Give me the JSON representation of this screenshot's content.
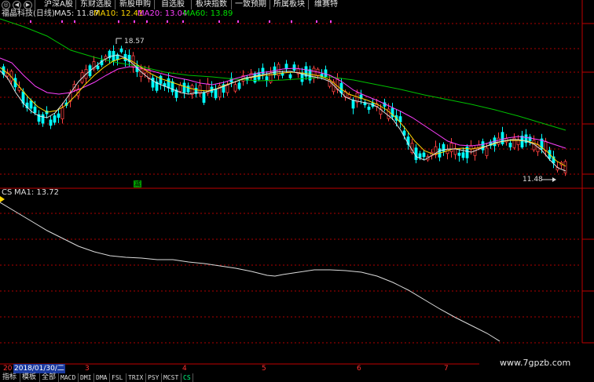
{
  "nav": {
    "icons": [
      "circle-icon",
      "left-arrow-icon",
      "right-arrow-icon"
    ],
    "tabs": [
      "沪深A股",
      "东财选股",
      "新股申购",
      "自选股",
      "板块指数",
      "一致预期",
      "所属板块",
      "维赛特"
    ]
  },
  "header": {
    "stock_name": "福晶科技(日线)",
    "ma5": "MA5: 11.87",
    "ma10": "MA10: 12.41",
    "ma20": "MA20: 13.04",
    "ma60": "MA60: 13.89"
  },
  "price_panel": {
    "high_label": "18.57",
    "low_label": "11.48",
    "reduce_marker": "减"
  },
  "indicator_panel": {
    "name": "CS",
    "ma1": "MA1: 13.72"
  },
  "timeline": {
    "year_label": "20",
    "cursor_date": "2018/01/30/二",
    "months": [
      "3",
      "4",
      "5",
      "6",
      "7"
    ]
  },
  "bottom_tabs": [
    "指标",
    "模板",
    "全部",
    "MACD",
    "DMI",
    "DMA",
    "FSL",
    "TRIX",
    "PSY",
    "MCST",
    "CS"
  ],
  "watermark": "www.7gpzb.com",
  "colors": {
    "up": "#ff4040",
    "down": "#00ffff",
    "ma5": "#ffffff",
    "ma10": "#ffd700",
    "ma20": "#ff40ff",
    "ma60": "#00c000",
    "grid": "#b00000"
  },
  "chart_data": {
    "type": "line",
    "series": [
      {
        "name": "MA5",
        "values": []
      },
      {
        "name": "MA10",
        "values": []
      },
      {
        "name": "MA20",
        "values": []
      },
      {
        "name": "MA60",
        "values": []
      },
      {
        "name": "MA1",
        "values": []
      }
    ]
  }
}
